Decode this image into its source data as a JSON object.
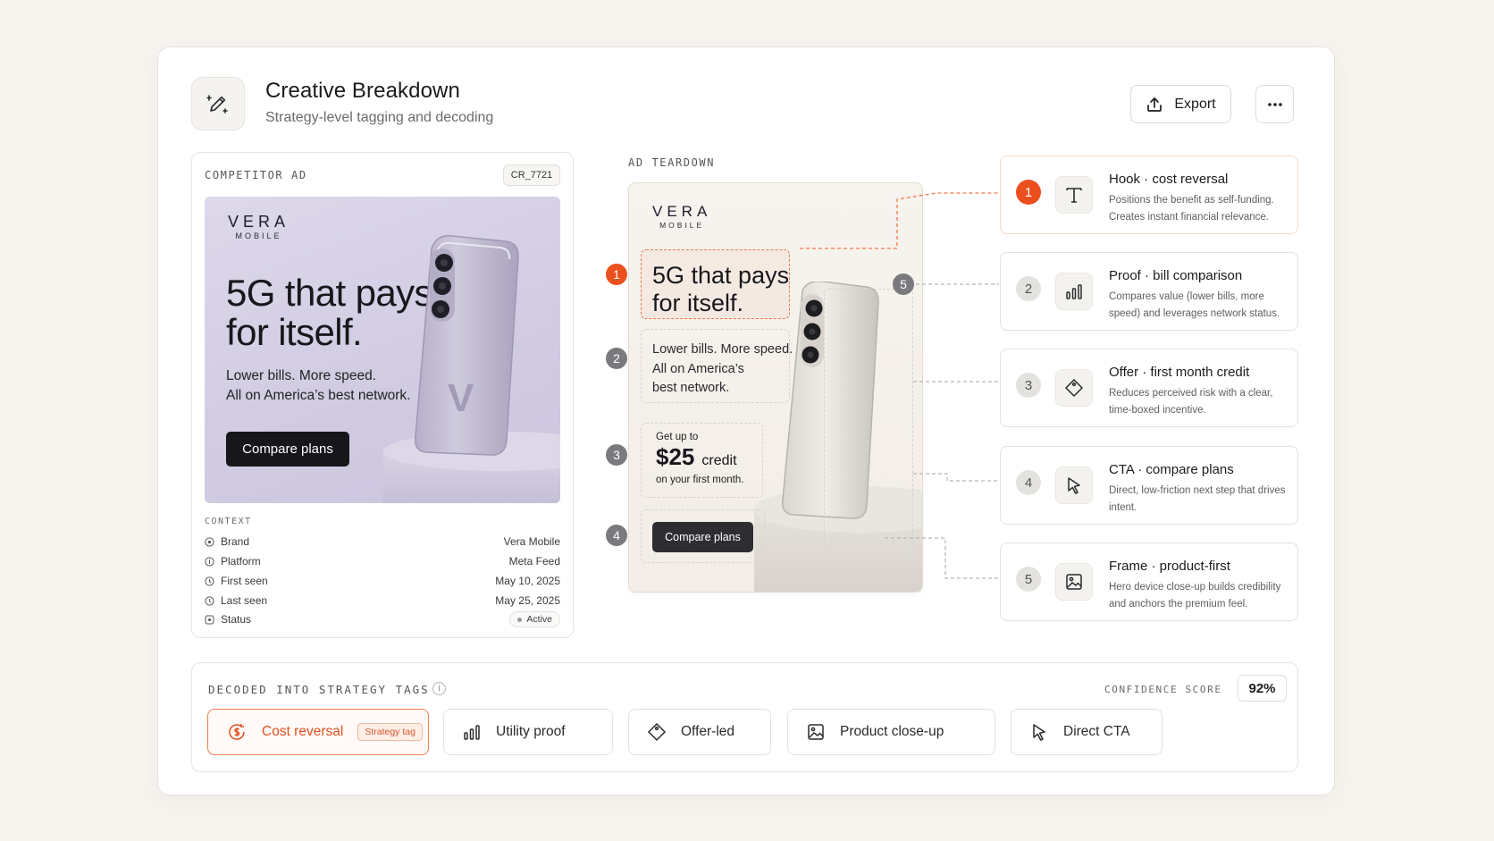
{
  "header": {
    "title": "Creative Breakdown",
    "subtitle": "Strategy-level tagging and decoding",
    "export_label": "Export"
  },
  "competitor": {
    "section_label": "COMPETITOR AD",
    "ad_id": "CR_7721",
    "ad": {
      "logo_main": "VERA",
      "logo_sub": "MOBILE",
      "headline_line1": "5G that pays",
      "headline_line2": "for itself.",
      "body_line1": "Lower bills. More speed.",
      "body_line2": "All on America’s best network.",
      "cta": "Compare plans",
      "device_mark": "V"
    },
    "context_label": "CONTEXT",
    "context": [
      {
        "key": "Brand",
        "value": "Vera Mobile",
        "icon": "tag-icon"
      },
      {
        "key": "Platform",
        "value": "Meta Feed",
        "icon": "platform-icon"
      },
      {
        "key": "First seen",
        "value": "May 10, 2025",
        "icon": "clock-icon"
      },
      {
        "key": "Last seen",
        "value": "May 25, 2025",
        "icon": "clock-icon"
      },
      {
        "key": "Status",
        "value": "Active",
        "icon": "status-icon"
      }
    ]
  },
  "teardown": {
    "section_label": "AD TEARDOWN",
    "ad": {
      "logo_main": "VERA",
      "logo_sub": "MOBILE",
      "headline_line1": "5G that pays",
      "headline_line2": "for itself.",
      "body_line1": "Lower bills. More speed.",
      "body_line2": "All on America’s",
      "body_line3": "best network.",
      "offer_top": "Get up to",
      "offer_amount": "$25",
      "offer_unit": "credit",
      "offer_bottom": "on your first month.",
      "cta": "Compare plans"
    },
    "markers": [
      "1",
      "2",
      "3",
      "4",
      "5"
    ],
    "annotations": [
      {
        "num": "1",
        "title": "Hook · cost reversal",
        "desc": "Positions the benefit as self-funding. Creates instant financial relevance.",
        "icon": "text-icon"
      },
      {
        "num": "2",
        "title": "Proof · bill comparison",
        "desc": "Compares value (lower bills, more speed) and leverages network status.",
        "icon": "bar-chart-icon"
      },
      {
        "num": "3",
        "title": "Offer · first month credit",
        "desc": "Reduces perceived risk with a clear, time-boxed incentive.",
        "icon": "price-tag-icon"
      },
      {
        "num": "4",
        "title": "CTA · compare plans",
        "desc": "Direct, low-friction next step that drives intent.",
        "icon": "cursor-icon"
      },
      {
        "num": "5",
        "title": "Frame · product-first",
        "desc": "Hero device close-up builds credibility and anchors the premium feel.",
        "icon": "image-icon"
      }
    ]
  },
  "decoded": {
    "section_label": "DECODED INTO STRATEGY TAGS",
    "info": "i",
    "confidence_label": "CONFIDENCE SCORE",
    "confidence_value": "92%",
    "tags": [
      {
        "label": "Cost reversal",
        "badge": "Strategy tag",
        "icon": "dollar-cycle-icon"
      },
      {
        "label": "Utility proof",
        "icon": "bar-chart-icon"
      },
      {
        "label": "Offer-led",
        "icon": "price-tag-icon"
      },
      {
        "label": "Product close-up",
        "icon": "image-icon"
      },
      {
        "label": "Direct CTA",
        "icon": "cursor-icon"
      }
    ]
  },
  "colors": {
    "accent": "#ec4f1e",
    "background": "#f7f4ef",
    "card": "#ffffff"
  }
}
